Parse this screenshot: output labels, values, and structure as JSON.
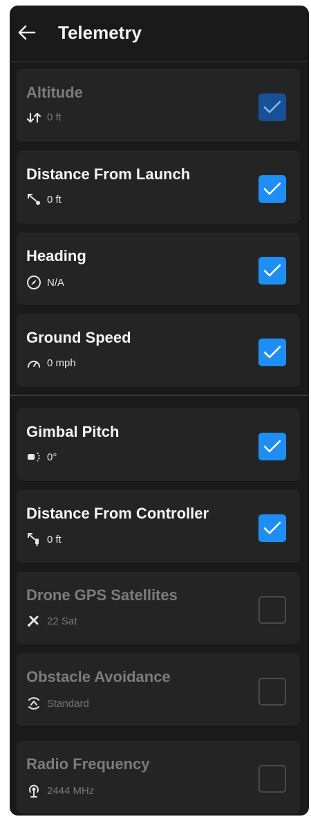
{
  "header": {
    "title": "Telemetry",
    "back_icon": "arrow-left-icon"
  },
  "items": [
    {
      "label": "Altitude",
      "value": "0 ft",
      "icon": "altitude-arrows-icon",
      "checked": true,
      "enabled": false
    },
    {
      "label": "Distance From Launch",
      "value": "0 ft",
      "icon": "distance-from-launch-icon",
      "checked": true,
      "enabled": true
    },
    {
      "label": "Heading",
      "value": "N/A",
      "icon": "compass-icon",
      "checked": true,
      "enabled": true
    },
    {
      "label": "Ground Speed",
      "value": "0 mph",
      "icon": "speedometer-icon",
      "checked": true,
      "enabled": true
    },
    {
      "label": "Gimbal Pitch",
      "value": "0°",
      "icon": "gimbal-pitch-icon",
      "checked": true,
      "enabled": true
    },
    {
      "label": "Distance From Controller",
      "value": "0 ft",
      "icon": "distance-from-controller-icon",
      "checked": true,
      "enabled": true
    },
    {
      "label": "Drone GPS Satellites",
      "value": "22 Sat",
      "icon": "satellite-icon",
      "checked": false,
      "enabled": false
    },
    {
      "label": "Obstacle Avoidance",
      "value": "Standard",
      "icon": "obstacle-avoidance-icon",
      "checked": false,
      "enabled": false
    },
    {
      "label": "Radio Frequency",
      "value": "2444 MHz",
      "icon": "radio-antenna-icon",
      "checked": false,
      "enabled": false
    }
  ],
  "colors": {
    "accent": "#1e8ef5",
    "background": "#1a1a1a",
    "card": "#242424"
  }
}
